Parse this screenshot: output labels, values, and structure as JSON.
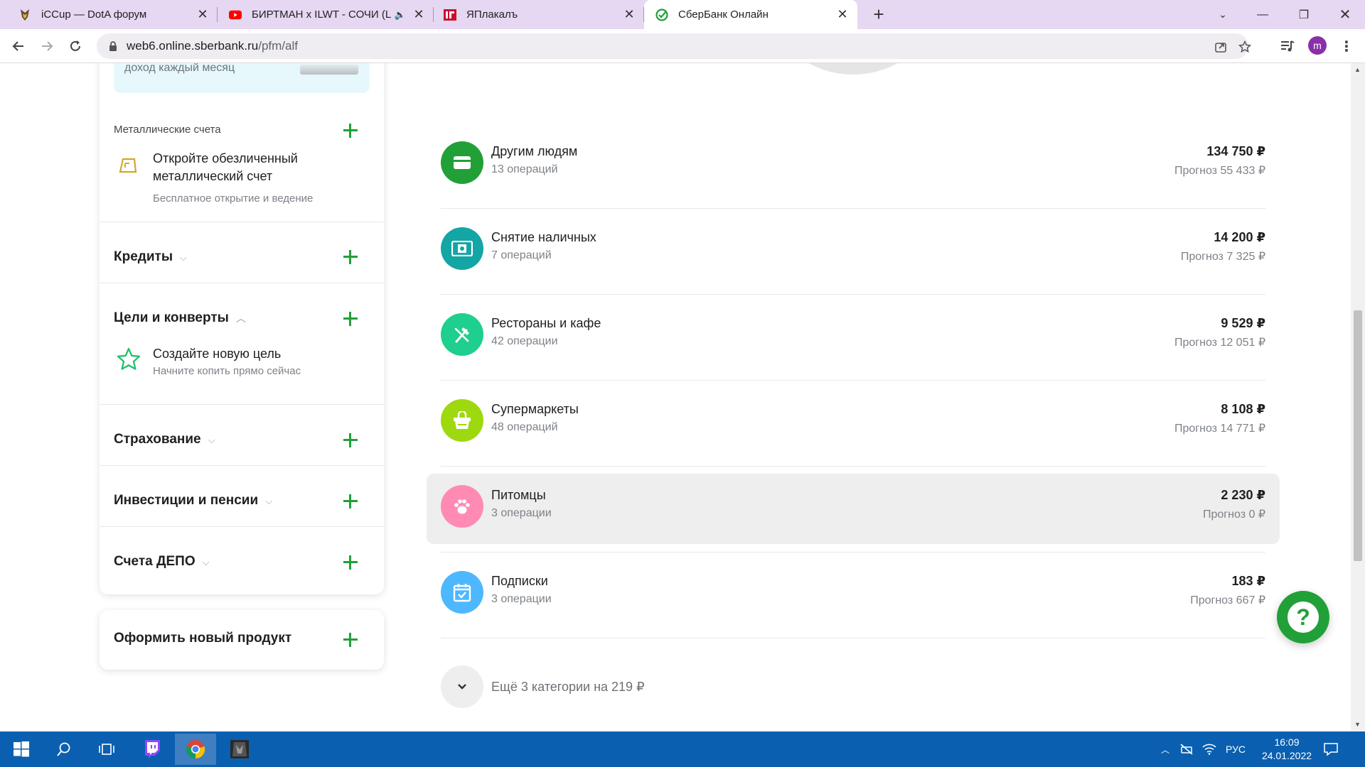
{
  "browser": {
    "tabs": [
      {
        "title": "iCCup — DotA форум",
        "icon": "iccup-favicon"
      },
      {
        "title": "БИРТМАН x ILWT - СОЧИ (L",
        "icon": "youtube-favicon"
      },
      {
        "title": "ЯПлакалъ",
        "icon": "yaplakal-favicon"
      },
      {
        "title": "СберБанк Онлайн",
        "icon": "sberbank-favicon"
      }
    ],
    "url_host": "web6.online.sberbank.ru",
    "url_path": "/pfm/alf",
    "profile_initial": "m"
  },
  "sidebar": {
    "promo_text": "доход каждый месяц",
    "metal": {
      "header": "Металлические счета",
      "item_title": "Откройте обезличенный металлический счет",
      "item_sub": "Бесплатное открытие и ведение"
    },
    "credits": "Кредиты",
    "goals": {
      "header": "Цели и конверты",
      "item_title": "Создайте новую цель",
      "item_sub": "Начните копить прямо сейчас"
    },
    "insurance": "Страхование",
    "investments": "Инвестиции и пенсии",
    "depo": "Счета ДЕПО",
    "new_product": "Оформить новый продукт"
  },
  "categories": [
    {
      "name": "Другим людям",
      "ops": "13 операций",
      "amount": "134 750 ₽",
      "forecast": "Прогноз 55 433 ₽",
      "icon": "card-icon",
      "color": "#21a038"
    },
    {
      "name": "Снятие наличных",
      "ops": "7 операций",
      "amount": "14 200 ₽",
      "forecast": "Прогноз 7 325 ₽",
      "icon": "cash-icon",
      "color": "#14a5a5"
    },
    {
      "name": "Рестораны и кафе",
      "ops": "42 операции",
      "amount": "9 529 ₽",
      "forecast": "Прогноз 12 051 ₽",
      "icon": "cutlery-icon",
      "color": "#1ecf8e"
    },
    {
      "name": "Супермаркеты",
      "ops": "48 операций",
      "amount": "8 108 ₽",
      "forecast": "Прогноз 14 771 ₽",
      "icon": "basket-icon",
      "color": "#9ed80f"
    },
    {
      "name": "Питомцы",
      "ops": "3 операции",
      "amount": "2 230 ₽",
      "forecast": "Прогноз 0 ₽",
      "icon": "paw-icon",
      "color": "#ff8ab4"
    },
    {
      "name": "Подписки",
      "ops": "3 операции",
      "amount": "183 ₽",
      "forecast": "Прогноз 667 ₽",
      "icon": "calendar-icon",
      "color": "#4db8ff"
    }
  ],
  "more_label": "Ещё 3 категории на 219 ₽",
  "taskbar": {
    "lang": "РУС",
    "time": "16:09",
    "date": "24.01.2022"
  }
}
